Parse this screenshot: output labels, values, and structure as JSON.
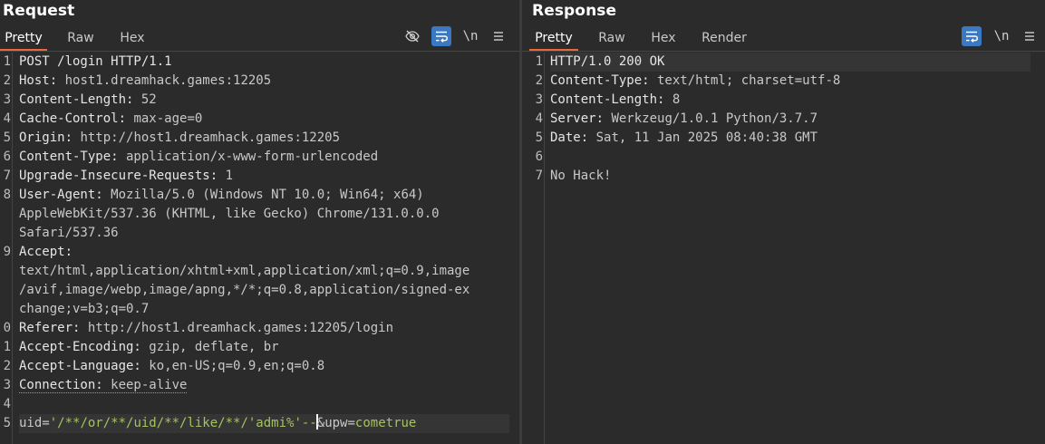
{
  "request": {
    "title": "Request",
    "tabs": [
      "Pretty",
      "Raw",
      "Hex"
    ],
    "active_tab": "Pretty",
    "tool_icons": [
      "eye-off-icon",
      "wrap-icon",
      "newline-icon",
      "menu-icon"
    ],
    "newline_label": "\\n",
    "gutter": [
      "1",
      "2",
      "3",
      "4",
      "5",
      "6",
      "7",
      "8",
      "",
      "",
      "9",
      "",
      "",
      "",
      "0",
      "1",
      "2",
      "3",
      "4",
      "5"
    ],
    "lines": [
      {
        "k": "POST /login HTTP/1.1",
        "v": ""
      },
      {
        "k": "Host:",
        "v": " host1.dreamhack.games:12205"
      },
      {
        "k": "Content-Length:",
        "v": " 52"
      },
      {
        "k": "Cache-Control:",
        "v": " max-age=0"
      },
      {
        "k": "Origin:",
        "v": " http://host1.dreamhack.games:12205"
      },
      {
        "k": "Content-Type:",
        "v": " application/x-www-form-urlencoded"
      },
      {
        "k": "Upgrade-Insecure-Requests:",
        "v": " 1"
      },
      {
        "k": "User-Agent:",
        "v": " Mozilla/5.0 (Windows NT 10.0; Win64; x64)"
      },
      {
        "k": "",
        "v": "AppleWebKit/537.36 (KHTML, like Gecko) Chrome/131.0.0.0"
      },
      {
        "k": "",
        "v": "Safari/537.36"
      },
      {
        "k": "Accept:",
        "v": ""
      },
      {
        "k": "",
        "v": "text/html,application/xhtml+xml,application/xml;q=0.9,image"
      },
      {
        "k": "",
        "v": "/avif,image/webp,image/apng,*/*;q=0.8,application/signed-ex"
      },
      {
        "k": "",
        "v": "change;v=b3;q=0.7"
      },
      {
        "k": "Referer:",
        "v": " http://host1.dreamhack.games:12205/login"
      },
      {
        "k": "Accept-Encoding:",
        "v": " gzip, deflate, br"
      },
      {
        "k": "Accept-Language:",
        "v": " ko,en-US;q=0.9,en;q=0.8"
      },
      {
        "k": "Connection:",
        "v": " keep-alive"
      },
      {
        "k": "",
        "v": ""
      }
    ],
    "body": {
      "p1": "uid",
      "eq1": "=",
      "v1a": "'/**/or/**/uid/**/like/**/'admi%'--",
      "v1b": "&",
      "p2": "upw",
      "eq2": "=",
      "v2": "cometrue"
    }
  },
  "response": {
    "title": "Response",
    "tabs": [
      "Pretty",
      "Raw",
      "Hex",
      "Render"
    ],
    "active_tab": "Pretty",
    "tool_icons": [
      "wrap-icon",
      "newline-icon",
      "menu-icon"
    ],
    "newline_label": "\\n",
    "gutter": [
      "1",
      "2",
      "3",
      "4",
      "5",
      "6",
      "7"
    ],
    "lines": [
      {
        "k": "HTTP/1.0 200 OK",
        "v": ""
      },
      {
        "k": "Content-Type:",
        "v": " text/html; charset=utf-8"
      },
      {
        "k": "Content-Length:",
        "v": " 8"
      },
      {
        "k": "Server:",
        "v": " Werkzeug/1.0.1 Python/3.7.7"
      },
      {
        "k": "Date:",
        "v": " Sat, 11 Jan 2025 08:40:38 GMT"
      },
      {
        "k": "",
        "v": ""
      },
      {
        "k": "",
        "v": "No Hack!"
      }
    ]
  },
  "colors": {
    "accent_tab": "#e8693a",
    "active_button": "#3a78c2",
    "param_value": "#a5c261"
  }
}
